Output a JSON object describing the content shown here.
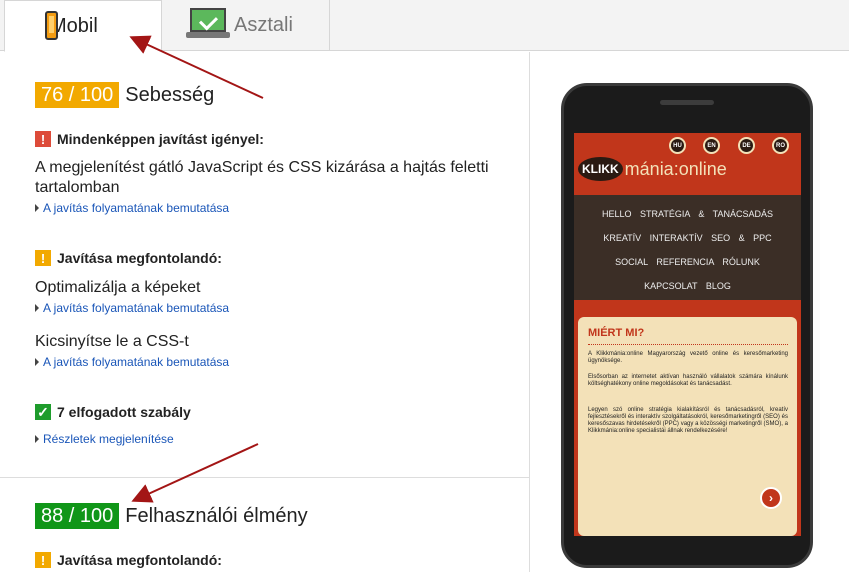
{
  "tabs": [
    {
      "label": "Mobil",
      "icon": "phone-icon",
      "active": true
    },
    {
      "label": "Asztali",
      "icon": "monitor-icon",
      "active": false
    }
  ],
  "speed": {
    "score": "76 / 100",
    "title": "Sebesség",
    "must_fix": {
      "heading": "Mindenképpen javítást igényel:",
      "rules": [
        {
          "title": "A megjelenítést gátló JavaScript és CSS kizárása a hajtás feletti tartalomban",
          "link": "A javítás folyamatának bemutatása"
        }
      ]
    },
    "consider": {
      "heading": "Javítása megfontolandó:",
      "rules": [
        {
          "title": "Optimalizálja a képeket",
          "link": "A javítás folyamatának bemutatása"
        },
        {
          "title": "Kicsinyítse le a CSS-t",
          "link": "A javítás folyamatának bemutatása"
        }
      ]
    },
    "passed": {
      "heading": "7 elfogadott szabály",
      "link": "Részletek megjelenítése"
    }
  },
  "ux": {
    "score": "88 / 100",
    "title": "Felhasználói élmény",
    "consider_heading": "Javítása megfontolandó:"
  },
  "preview": {
    "langs": [
      "HU",
      "EN",
      "DE",
      "RO"
    ],
    "logo_mark": "KLIKK",
    "logo_text": "mánia:online",
    "menu_rows": [
      "HELLO STRATÉGIA & TANÁCSADÁS",
      "KREATÍV INTERAKTÍV SEO & PPC",
      "SOCIAL REFERENCIA RÓLUNK",
      "KAPCSOLAT BLOG"
    ],
    "box_title": "MIÉRT MI?",
    "paragraphs": [
      "A Klikkmánia:online Magyarország vezető online és keresőmarketing ügynöksége.",
      "Elsősorban az internetet aktívan használó vállalatok számára kínálunk költséghatékony online megoldásokat és tanácsadást.",
      "Legyen szó online stratégia kialakításról és tanácsadásról, kreatív fejlesztésekről és interaktív szolgáltatásokról, keresőmarketingről (SEO) és keresőszavas hirdetésekről (PPC) vagy a közösségi marketingről (SMO), a Klikkmánia:online specialistái állnak rendelkezésére!"
    ],
    "more_button": "›"
  },
  "colors": {
    "score_orange": "#f2a900",
    "score_green": "#109618",
    "link_blue": "#1a56b8",
    "arrow_red": "#a31515"
  }
}
